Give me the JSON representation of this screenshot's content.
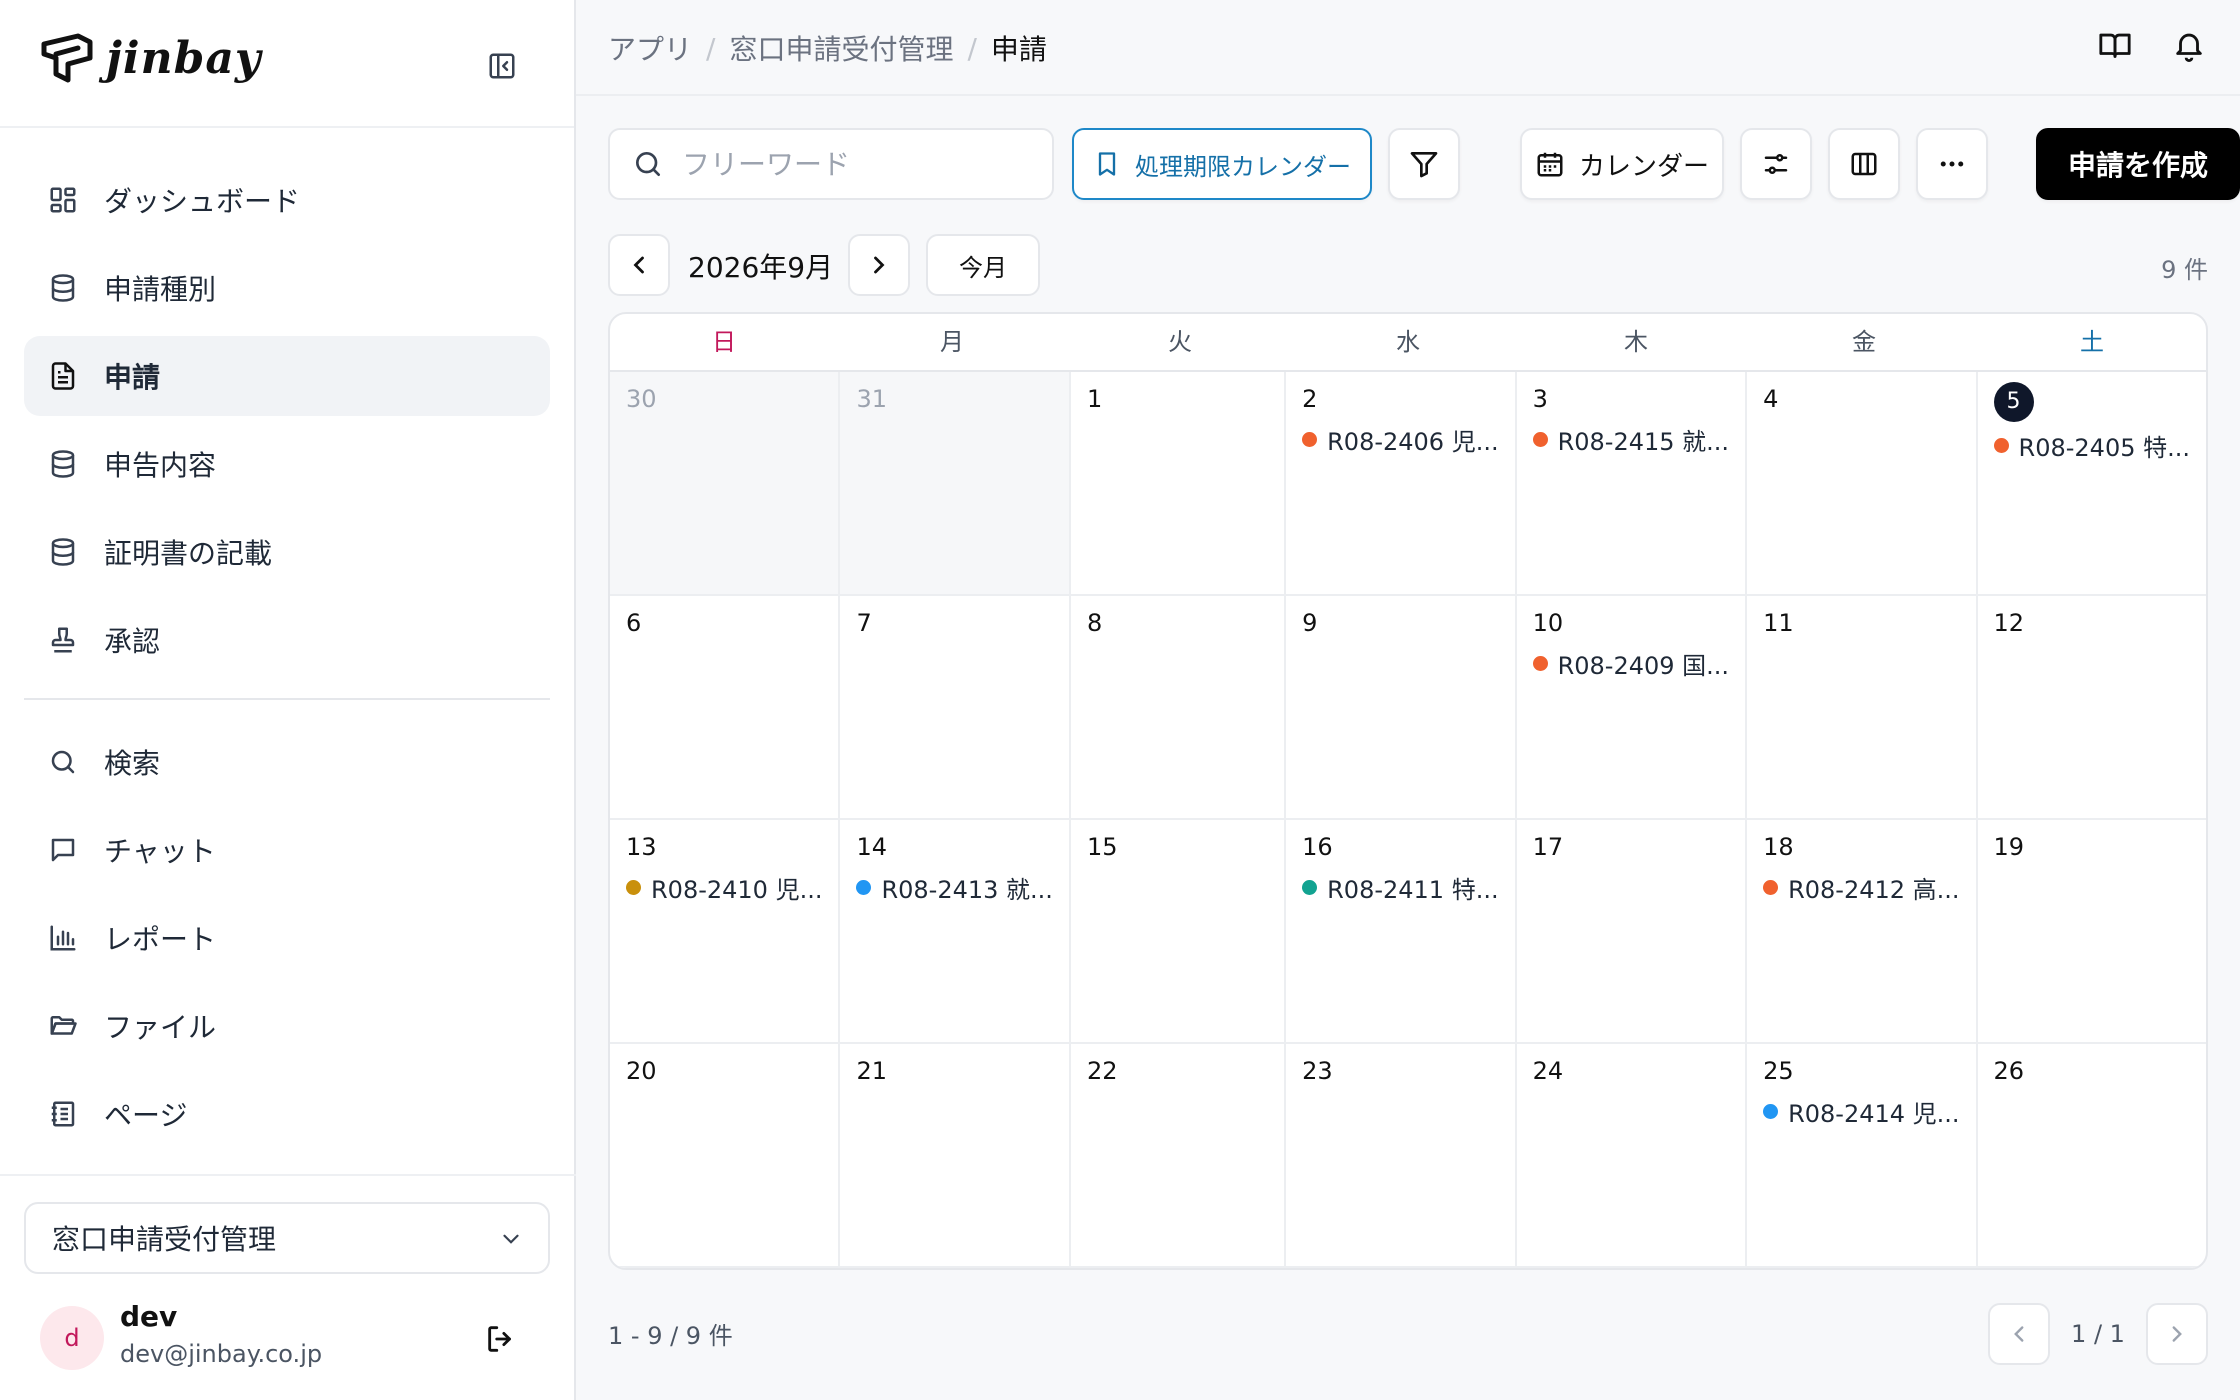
{
  "app": {
    "logo_text": "jinbay"
  },
  "sidebar": {
    "items": [
      {
        "label": "ダッシュボード",
        "icon": "dashboard-icon"
      },
      {
        "label": "申請種別",
        "icon": "database-icon"
      },
      {
        "label": "申請",
        "icon": "document-icon",
        "active": true
      },
      {
        "label": "申告内容",
        "icon": "database-icon"
      },
      {
        "label": "証明書の記載",
        "icon": "database-icon"
      },
      {
        "label": "承認",
        "icon": "stamp-icon"
      }
    ],
    "tools": [
      {
        "label": "検索",
        "icon": "search-icon"
      },
      {
        "label": "チャット",
        "icon": "chat-icon"
      },
      {
        "label": "レポート",
        "icon": "chart-icon"
      },
      {
        "label": "ファイル",
        "icon": "folder-icon"
      },
      {
        "label": "ページ",
        "icon": "notebook-icon"
      }
    ],
    "workspace": "窓口申請受付管理",
    "user": {
      "initial": "d",
      "name": "dev",
      "email": "dev@jinbay.co.jp"
    }
  },
  "breadcrumb": {
    "items": [
      "アプリ",
      "窓口申請受付管理"
    ],
    "current": "申請"
  },
  "toolbar": {
    "search_placeholder": "フリーワード",
    "saved_view_label": "処理期限カレンダー",
    "view_label": "カレンダー",
    "create_label": "申請を作成"
  },
  "month": {
    "label": "2026年9月",
    "today_label": "今月",
    "count_label": "9 件"
  },
  "calendar": {
    "weekdays": [
      "日",
      "月",
      "火",
      "水",
      "木",
      "金",
      "土"
    ],
    "weekday_colors": [
      "#c2185b",
      "#4b5563",
      "#4b5563",
      "#4b5563",
      "#4b5563",
      "#4b5563",
      "#1570a8"
    ],
    "weeks": [
      [
        {
          "day": "30",
          "out": true,
          "events": []
        },
        {
          "day": "31",
          "out": true,
          "events": []
        },
        {
          "day": "1",
          "events": []
        },
        {
          "day": "2",
          "events": [
            {
              "text": "R08-2406 児...",
              "color": "#f0612e"
            }
          ]
        },
        {
          "day": "3",
          "events": [
            {
              "text": "R08-2415 就...",
              "color": "#f0612e"
            }
          ]
        },
        {
          "day": "4",
          "events": []
        },
        {
          "day": "5",
          "today": true,
          "events": [
            {
              "text": "R08-2405 特...",
              "color": "#f0612e"
            }
          ]
        }
      ],
      [
        {
          "day": "6",
          "events": []
        },
        {
          "day": "7",
          "events": []
        },
        {
          "day": "8",
          "events": []
        },
        {
          "day": "9",
          "events": []
        },
        {
          "day": "10",
          "events": [
            {
              "text": "R08-2409 国...",
              "color": "#f0612e"
            }
          ]
        },
        {
          "day": "11",
          "events": []
        },
        {
          "day": "12",
          "events": []
        }
      ],
      [
        {
          "day": "13",
          "events": [
            {
              "text": "R08-2410 児...",
              "color": "#c9900c"
            }
          ]
        },
        {
          "day": "14",
          "events": [
            {
              "text": "R08-2413 就...",
              "color": "#2196f3"
            }
          ]
        },
        {
          "day": "15",
          "events": []
        },
        {
          "day": "16",
          "events": [
            {
              "text": "R08-2411 特...",
              "color": "#12a391"
            }
          ]
        },
        {
          "day": "17",
          "events": []
        },
        {
          "day": "18",
          "events": [
            {
              "text": "R08-2412 高...",
              "color": "#f0612e"
            }
          ]
        },
        {
          "day": "19",
          "events": []
        }
      ],
      [
        {
          "day": "20",
          "events": []
        },
        {
          "day": "21",
          "events": []
        },
        {
          "day": "22",
          "events": []
        },
        {
          "day": "23",
          "events": []
        },
        {
          "day": "24",
          "events": []
        },
        {
          "day": "25",
          "events": [
            {
              "text": "R08-2414 児...",
              "color": "#2196f3"
            }
          ]
        },
        {
          "day": "26",
          "events": []
        }
      ]
    ]
  },
  "footer": {
    "range_label": "1 - 9 / 9 件",
    "page_label": "1 / 1"
  }
}
